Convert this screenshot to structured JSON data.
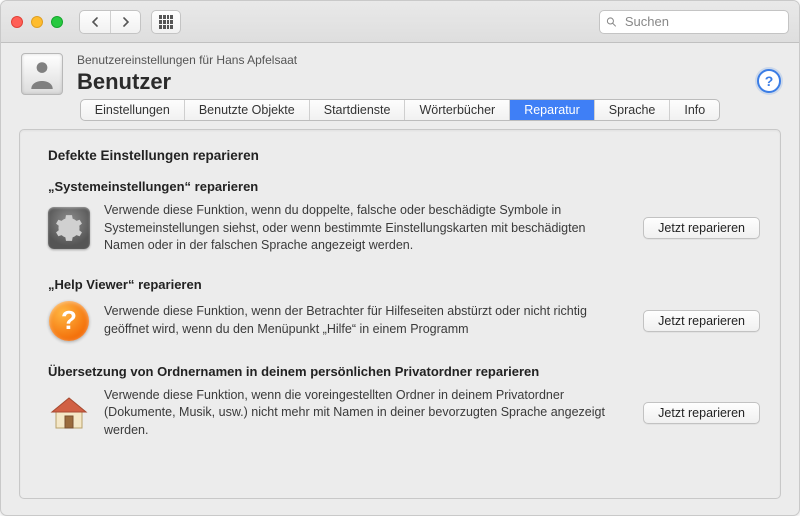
{
  "toolbar": {
    "search_placeholder": "Suchen"
  },
  "header": {
    "subtitle": "Benutzereinstellungen für Hans Apfelsaat",
    "title": "Benutzer",
    "help_label": "?"
  },
  "tabs": [
    {
      "label": "Einstellungen",
      "active": false
    },
    {
      "label": "Benutzte Objekte",
      "active": false
    },
    {
      "label": "Startdienste",
      "active": false
    },
    {
      "label": "Wörterbücher",
      "active": false
    },
    {
      "label": "Reparatur",
      "active": true
    },
    {
      "label": "Sprache",
      "active": false
    },
    {
      "label": "Info",
      "active": false
    }
  ],
  "content": {
    "section_heading": "Defekte Einstellungen reparieren",
    "items": [
      {
        "title": "„Systemeinstellungen“ reparieren",
        "desc": "Verwende diese Funktion, wenn du doppelte, falsche oder beschädigte Symbole in Systemeinstellungen siehst, oder wenn bestimmte Einstellungskarten mit beschädigten Namen oder in der falschen Sprache angezeigt werden.",
        "button": "Jetzt reparieren",
        "icon": "gear"
      },
      {
        "title": "„Help Viewer“ reparieren",
        "desc": "Verwende diese Funktion, wenn der Betrachter für Hilfeseiten abstürzt oder nicht richtig geöffnet wird, wenn du den Menüpunkt „Hilfe“ in einem Programm",
        "button": "Jetzt reparieren",
        "icon": "question"
      },
      {
        "title": "Übersetzung von Ordnernamen in deinem persönlichen Privatordner reparieren",
        "desc": "Verwende diese Funktion, wenn die voreingestellten Ordner in deinem Privatordner (Dokumente, Musik, usw.) nicht mehr mit Namen in deiner bevorzugten Sprache angezeigt werden.",
        "button": "Jetzt reparieren",
        "icon": "home"
      }
    ]
  }
}
